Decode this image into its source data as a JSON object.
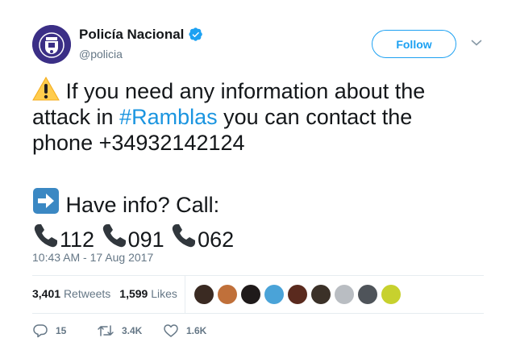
{
  "account": {
    "display_name": "Policía Nacional",
    "handle": "@policia",
    "verified": true,
    "avatar_icon": "police-badge-emblem",
    "follow_label": "Follow"
  },
  "tweet": {
    "line1_pre": "If you need any information about the",
    "line2_pre": "attack in ",
    "hashtag": "#Ramblas",
    "line2_post": " you can contact the",
    "line3": "phone +34932142124",
    "line4": "Have info? Call:",
    "calls": [
      "112",
      "091",
      "062"
    ],
    "timestamp": "10:43 AM - 17 Aug 2017"
  },
  "stats": {
    "retweets_count": "3,401",
    "retweets_label": "Retweets",
    "likes_count": "1,599",
    "likes_label": "Likes"
  },
  "liker_avatars": [
    "#3a2a22",
    "#c0703a",
    "#1f1a1a",
    "#4aa3d8",
    "#5a2a1e",
    "#3b3128",
    "#b9bdc2",
    "#4f545a",
    "#c7d12e"
  ],
  "actions": {
    "reply_count": "15",
    "retweet_count": "3.4K",
    "like_count": "1.6K"
  },
  "colors": {
    "accent": "#1da1f2",
    "hashtag": "#1b95e0",
    "muted": "#657786"
  }
}
